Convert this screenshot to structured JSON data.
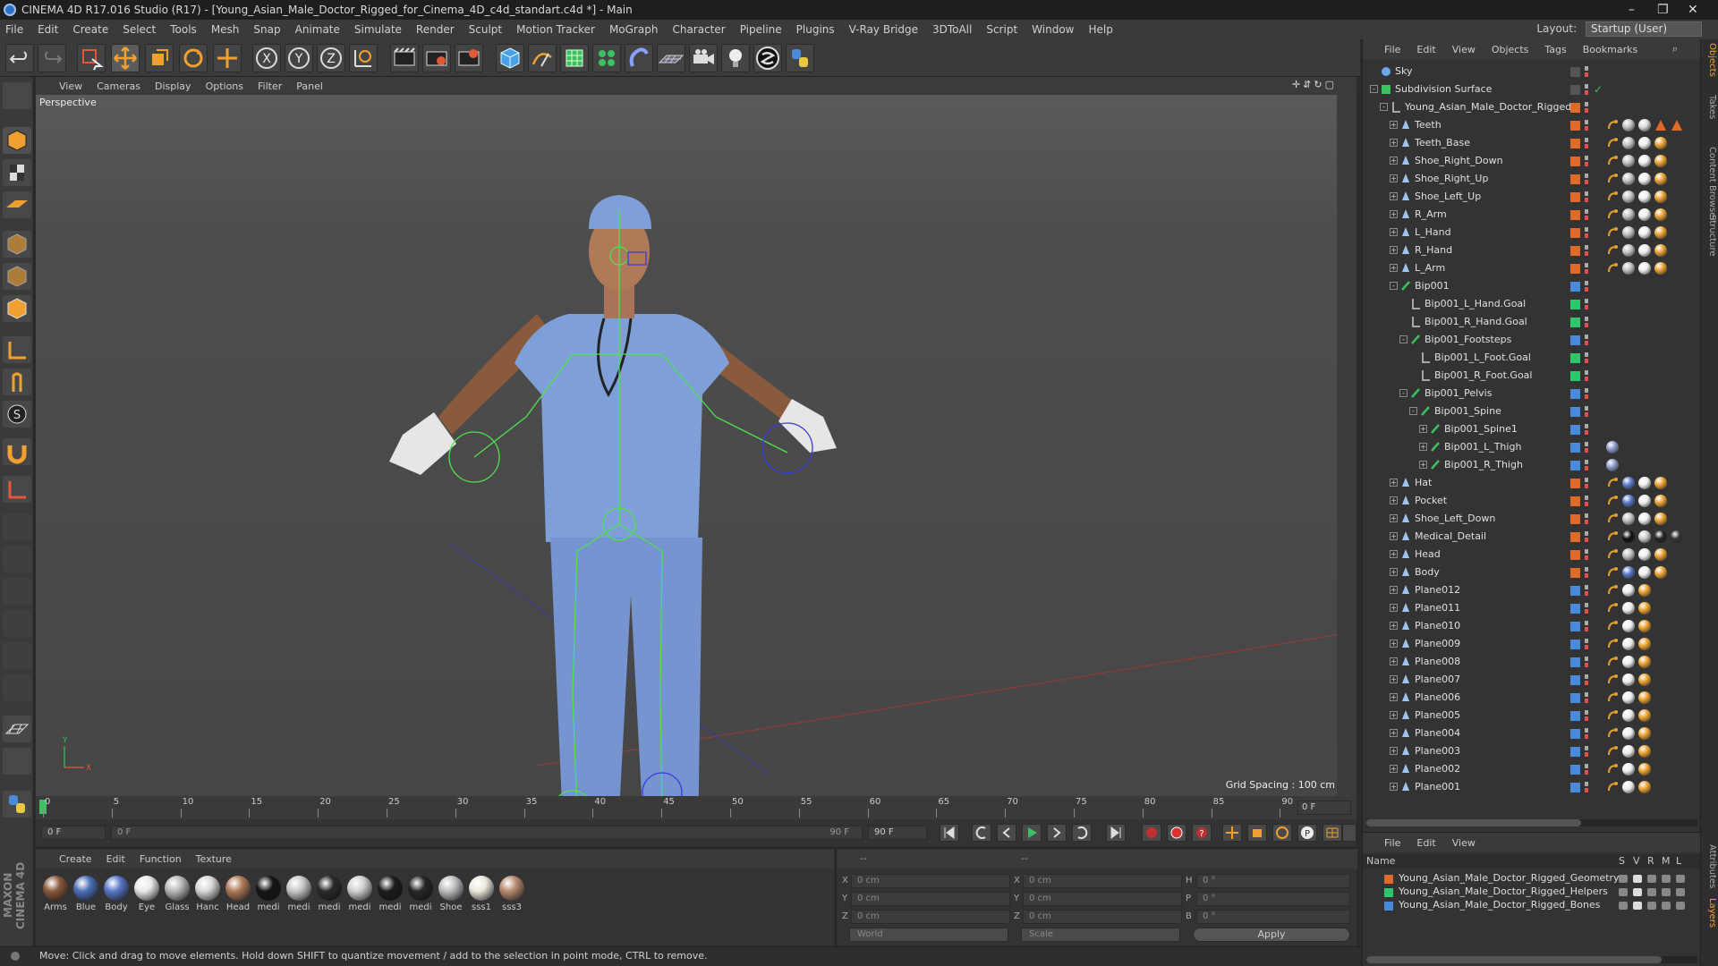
{
  "window": {
    "title": "CINEMA 4D R17.016 Studio (R17) - [Young_Asian_Male_Doctor_Rigged_for_Cinema_4D_c4d_standart.c4d *] - Main"
  },
  "menu": [
    "File",
    "Edit",
    "Create",
    "Select",
    "Tools",
    "Mesh",
    "Snap",
    "Animate",
    "Simulate",
    "Render",
    "Sculpt",
    "Motion Tracker",
    "MoGraph",
    "Character",
    "Pipeline",
    "Plugins",
    "V-Ray Bridge",
    "3DToAll",
    "Script",
    "Window",
    "Help"
  ],
  "layout": {
    "label": "Layout:",
    "value": "Startup (User)"
  },
  "toolbar_axes": [
    "X",
    "Y",
    "Z"
  ],
  "viewport": {
    "menu": [
      "View",
      "Cameras",
      "Display",
      "Options",
      "Filter",
      "Panel"
    ],
    "camera_label": "Perspective",
    "grid_spacing": "Grid Spacing : 100 cm",
    "axis_y": "Y",
    "axis_x": "X"
  },
  "timeline": {
    "ticks": [
      "0",
      "5",
      "10",
      "15",
      "20",
      "25",
      "30",
      "35",
      "40",
      "45",
      "50",
      "55",
      "60",
      "65",
      "70",
      "75",
      "80",
      "85",
      "90"
    ],
    "end_frame": "0 F"
  },
  "transport": {
    "start": "0 F",
    "range_start": "0 F",
    "range_end": "90 F",
    "end": "90 F"
  },
  "materials": {
    "menu": [
      "Create",
      "Edit",
      "Function",
      "Texture"
    ],
    "items": [
      {
        "label": "Arms",
        "color": "#8a5a3c"
      },
      {
        "label": "Blue",
        "color": "#4c6fb8"
      },
      {
        "label": "Body",
        "color": "#5877c8"
      },
      {
        "label": "Eye",
        "color": "#e8e8e8"
      },
      {
        "label": "Glass",
        "color": "#b8b8b8"
      },
      {
        "label": "Hanc",
        "color": "#d8d8d8"
      },
      {
        "label": "Head",
        "color": "#b07a58"
      },
      {
        "label": "medi",
        "color": "#151515"
      },
      {
        "label": "medi",
        "color": "#c8c8c8"
      },
      {
        "label": "medi",
        "color": "#2a2a2a"
      },
      {
        "label": "medi",
        "color": "#cfcfcf"
      },
      {
        "label": "medi",
        "color": "#1c1c1c"
      },
      {
        "label": "medi",
        "color": "#262626"
      },
      {
        "label": "Shoe",
        "color": "#bdbdbd"
      },
      {
        "label": "sss1",
        "color": "#ece8dc"
      },
      {
        "label": "sss3",
        "color": "#b88a70"
      }
    ]
  },
  "coords": {
    "header": "--",
    "header2": "--",
    "rows": [
      {
        "l1": "X",
        "v1": "0 cm",
        "l2": "X",
        "v2": "0 cm",
        "l3": "H",
        "v3": "0 °"
      },
      {
        "l1": "Y",
        "v1": "0 cm",
        "l2": "Y",
        "v2": "0 cm",
        "l3": "P",
        "v3": "0 °"
      },
      {
        "l1": "Z",
        "v1": "0 cm",
        "l2": "Z",
        "v2": "0 cm",
        "l3": "B",
        "v3": "0 °"
      }
    ],
    "world": "World",
    "scale": "Scale",
    "apply": "Apply"
  },
  "status": "Move: Click and drag to move elements. Hold down SHIFT to quantize movement / add to the selection in point mode, CTRL to remove.",
  "object_manager": {
    "menu": [
      "File",
      "Edit",
      "View",
      "Objects",
      "Tags",
      "Bookmarks"
    ],
    "rows": [
      {
        "name": "Sky",
        "indent": 0,
        "exp": "",
        "icon": "sky",
        "layer": "",
        "vis": "#8a8a8a",
        "tags": "none"
      },
      {
        "name": "Subdivision Surface",
        "indent": 0,
        "exp": "-",
        "icon": "subd",
        "layer": "",
        "vis": "#8a8a8a",
        "tags": "check"
      },
      {
        "name": "Young_Asian_Male_Doctor_Rigged",
        "indent": 1,
        "exp": "-",
        "icon": "null",
        "layer": "#e06a2a",
        "vis": "#8a8a8a",
        "tags": "none"
      },
      {
        "name": "Teeth",
        "indent": 2,
        "exp": "+",
        "icon": "bone",
        "layer": "#e06a2a",
        "vis": "#8a8a8a",
        "tags": "mat4"
      },
      {
        "name": "Teeth_Base",
        "indent": 2,
        "exp": "+",
        "icon": "bone",
        "layer": "#e06a2a",
        "vis": "#8a8a8a",
        "tags": "mat3"
      },
      {
        "name": "Shoe_Right_Down",
        "indent": 2,
        "exp": "+",
        "icon": "bone",
        "layer": "#e06a2a",
        "vis": "#8a8a8a",
        "tags": "mat3"
      },
      {
        "name": "Shoe_Right_Up",
        "indent": 2,
        "exp": "+",
        "icon": "bone",
        "layer": "#e06a2a",
        "vis": "#8a8a8a",
        "tags": "mat3"
      },
      {
        "name": "Shoe_Left_Up",
        "indent": 2,
        "exp": "+",
        "icon": "bone",
        "layer": "#e06a2a",
        "vis": "#8a8a8a",
        "tags": "mat3"
      },
      {
        "name": "R_Arm",
        "indent": 2,
        "exp": "+",
        "icon": "bone",
        "layer": "#e06a2a",
        "vis": "#8a8a8a",
        "tags": "mat3"
      },
      {
        "name": "L_Hand",
        "indent": 2,
        "exp": "+",
        "icon": "bone",
        "layer": "#e06a2a",
        "vis": "#8a8a8a",
        "tags": "mat3"
      },
      {
        "name": "R_Hand",
        "indent": 2,
        "exp": "+",
        "icon": "bone",
        "layer": "#e06a2a",
        "vis": "#8a8a8a",
        "tags": "mat3"
      },
      {
        "name": "L_Arm",
        "indent": 2,
        "exp": "+",
        "icon": "bone",
        "layer": "#e06a2a",
        "vis": "#8a8a8a",
        "tags": "mat3"
      },
      {
        "name": "Bip001",
        "indent": 2,
        "exp": "-",
        "icon": "bip",
        "layer": "#4a8ad8",
        "vis": "#8a8a8a",
        "tags": "none"
      },
      {
        "name": "Bip001_L_Hand.Goal",
        "indent": 3,
        "exp": "",
        "icon": "null",
        "layer": "#2ec86a",
        "vis": "#8a8a8a",
        "tags": "none"
      },
      {
        "name": "Bip001_R_Hand.Goal",
        "indent": 3,
        "exp": "",
        "icon": "null",
        "layer": "#2ec86a",
        "vis": "#8a8a8a",
        "tags": "none"
      },
      {
        "name": "Bip001_Footsteps",
        "indent": 3,
        "exp": "-",
        "icon": "bip",
        "layer": "#4a8ad8",
        "vis": "#8a8a8a",
        "tags": "none"
      },
      {
        "name": "Bip001_L_Foot.Goal",
        "indent": 4,
        "exp": "",
        "icon": "null",
        "layer": "#2ec86a",
        "vis": "#8a8a8a",
        "tags": "none"
      },
      {
        "name": "Bip001_R_Foot.Goal",
        "indent": 4,
        "exp": "",
        "icon": "null",
        "layer": "#2ec86a",
        "vis": "#8a8a8a",
        "tags": "none"
      },
      {
        "name": "Bip001_Pelvis",
        "indent": 3,
        "exp": "-",
        "icon": "bip",
        "layer": "#4a8ad8",
        "vis": "#8a8a8a",
        "tags": "none"
      },
      {
        "name": "Bip001_Spine",
        "indent": 4,
        "exp": "-",
        "icon": "bip",
        "layer": "#4a8ad8",
        "vis": "#8a8a8a",
        "tags": "none"
      },
      {
        "name": "Bip001_Spine1",
        "indent": 5,
        "exp": "+",
        "icon": "bip",
        "layer": "#4a8ad8",
        "vis": "#8a8a8a",
        "tags": "none"
      },
      {
        "name": "Bip001_L_Thigh",
        "indent": 5,
        "exp": "+",
        "icon": "bip",
        "layer": "#4a8ad8",
        "vis": "#8a8a8a",
        "tags": "ik"
      },
      {
        "name": "Bip001_R_Thigh",
        "indent": 5,
        "exp": "+",
        "icon": "bip",
        "layer": "#4a8ad8",
        "vis": "#8a8a8a",
        "tags": "ik"
      },
      {
        "name": "Hat",
        "indent": 2,
        "exp": "+",
        "icon": "bone",
        "layer": "#e06a2a",
        "vis": "#8a8a8a",
        "tags": "mat3b"
      },
      {
        "name": "Pocket",
        "indent": 2,
        "exp": "+",
        "icon": "bone",
        "layer": "#e06a2a",
        "vis": "#8a8a8a",
        "tags": "mat3b"
      },
      {
        "name": "Shoe_Left_Down",
        "indent": 2,
        "exp": "+",
        "icon": "bone",
        "layer": "#e06a2a",
        "vis": "#8a8a8a",
        "tags": "mat3"
      },
      {
        "name": "Medical_Detail",
        "indent": 2,
        "exp": "+",
        "icon": "bone",
        "layer": "#e06a2a",
        "vis": "#8a8a8a",
        "tags": "mat5"
      },
      {
        "name": "Head",
        "indent": 2,
        "exp": "+",
        "icon": "bone",
        "layer": "#e06a2a",
        "vis": "#8a8a8a",
        "tags": "mat3"
      },
      {
        "name": "Body",
        "indent": 2,
        "exp": "+",
        "icon": "bone",
        "layer": "#e06a2a",
        "vis": "#8a8a8a",
        "tags": "mat3b"
      },
      {
        "name": "Plane012",
        "indent": 2,
        "exp": "+",
        "icon": "bone",
        "layer": "#4a8ad8",
        "vis": "#8a8a8a",
        "tags": "mat2"
      },
      {
        "name": "Plane011",
        "indent": 2,
        "exp": "+",
        "icon": "bone",
        "layer": "#4a8ad8",
        "vis": "#8a8a8a",
        "tags": "mat2"
      },
      {
        "name": "Plane010",
        "indent": 2,
        "exp": "+",
        "icon": "bone",
        "layer": "#4a8ad8",
        "vis": "#8a8a8a",
        "tags": "mat2"
      },
      {
        "name": "Plane009",
        "indent": 2,
        "exp": "+",
        "icon": "bone",
        "layer": "#4a8ad8",
        "vis": "#8a8a8a",
        "tags": "mat2"
      },
      {
        "name": "Plane008",
        "indent": 2,
        "exp": "+",
        "icon": "bone",
        "layer": "#4a8ad8",
        "vis": "#8a8a8a",
        "tags": "mat2"
      },
      {
        "name": "Plane007",
        "indent": 2,
        "exp": "+",
        "icon": "bone",
        "layer": "#4a8ad8",
        "vis": "#8a8a8a",
        "tags": "mat2"
      },
      {
        "name": "Plane006",
        "indent": 2,
        "exp": "+",
        "icon": "bone",
        "layer": "#4a8ad8",
        "vis": "#8a8a8a",
        "tags": "mat2"
      },
      {
        "name": "Plane005",
        "indent": 2,
        "exp": "+",
        "icon": "bone",
        "layer": "#4a8ad8",
        "vis": "#8a8a8a",
        "tags": "mat2"
      },
      {
        "name": "Plane004",
        "indent": 2,
        "exp": "+",
        "icon": "bone",
        "layer": "#4a8ad8",
        "vis": "#8a8a8a",
        "tags": "mat2"
      },
      {
        "name": "Plane003",
        "indent": 2,
        "exp": "+",
        "icon": "bone",
        "layer": "#4a8ad8",
        "vis": "#8a8a8a",
        "tags": "mat2"
      },
      {
        "name": "Plane002",
        "indent": 2,
        "exp": "+",
        "icon": "bone",
        "layer": "#4a8ad8",
        "vis": "#8a8a8a",
        "tags": "mat2"
      },
      {
        "name": "Plane001",
        "indent": 2,
        "exp": "+",
        "icon": "bone",
        "layer": "#4a8ad8",
        "vis": "#8a8a8a",
        "tags": "mat2"
      }
    ]
  },
  "layer_manager": {
    "menu": [
      "File",
      "Edit",
      "View"
    ],
    "columns": {
      "name": "Name",
      "s": "S",
      "v": "V",
      "r": "R",
      "m": "M",
      "l": "L"
    },
    "layers": [
      {
        "name": "Young_Asian_Male_Doctor_Rigged_Geometry",
        "color": "#e06a2a"
      },
      {
        "name": "Young_Asian_Male_Doctor_Rigged_Helpers",
        "color": "#2ec86a"
      },
      {
        "name": "Young_Asian_Male_Doctor_Rigged_Bones",
        "color": "#4a8ad8"
      }
    ]
  },
  "side_tabs": [
    "Objects",
    "Takes",
    "Content Browser",
    "Structure",
    "Attributes",
    "Layers"
  ],
  "brand": "MAXON CINEMA 4D"
}
